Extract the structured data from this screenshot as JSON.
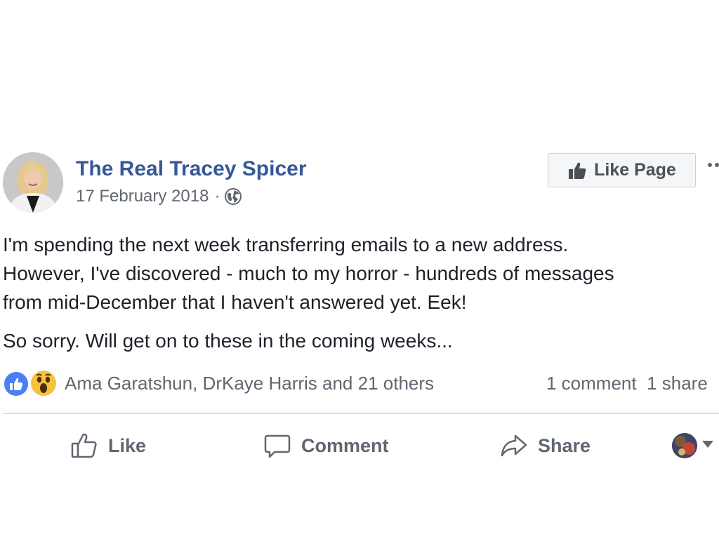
{
  "post": {
    "author": "The Real Tracey Spicer",
    "date": "17 February 2018",
    "separator": "·",
    "audience_icon": "globe-icon",
    "like_page_label": "Like Page",
    "more_icon": "more-options-icon",
    "paragraphs": [
      "I'm spending the next week transferring emails to a new address.",
      "However, I've discovered - much to my horror - hundreds of messages",
      "from mid-December that I haven't answered yet. Eek!"
    ],
    "paragraph2": "So sorry. Will get on to these in the coming weeks..."
  },
  "reactions": {
    "icons": [
      "like-reaction-icon",
      "wow-reaction-icon"
    ],
    "names": "Ama Garatshun, DrKaye Harris and 21 others",
    "comments": "1 comment",
    "shares": "1 share"
  },
  "actions": {
    "like": "Like",
    "comment": "Comment",
    "share": "Share"
  },
  "colors": {
    "link_blue": "#365899",
    "secondary_text": "#616770",
    "like_blue": "#4a7ff5",
    "wow_yellow": "#f7c23c"
  }
}
